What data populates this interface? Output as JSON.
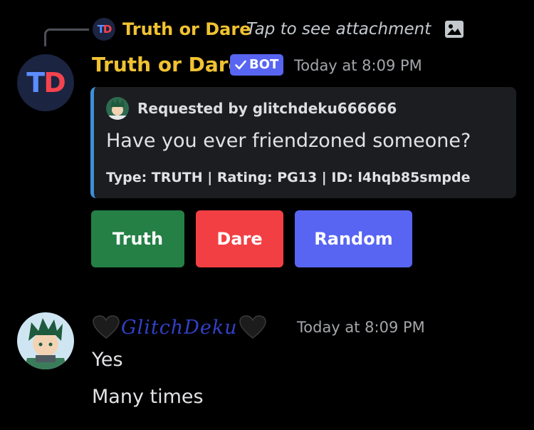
{
  "reply": {
    "author": "Truth or Dare",
    "preview": "Tap to see attachment",
    "avatar_initials": [
      "T",
      "D"
    ],
    "attachment_icon": "image-icon"
  },
  "bot_message": {
    "author": "Truth or Dare",
    "badge": "BOT",
    "badge_icon": "checkmark-icon",
    "timestamp": "Today at 8:09 PM",
    "avatar_initials": [
      "T",
      "D"
    ],
    "embed": {
      "accent_color": "#3c8fd6",
      "author": "Requested by glitchdeku666666",
      "description": "Have you ever friendzoned someone?",
      "footer": "Type: TRUTH | Rating: PG13 | ID: l4hqb85smpde"
    },
    "buttons": [
      {
        "label": "Truth",
        "color": "#248045"
      },
      {
        "label": "Dare",
        "color": "#f23f43"
      },
      {
        "label": "Random",
        "color": "#5865f2"
      }
    ]
  },
  "user_message": {
    "author": "GlitchDeku",
    "author_decoration": "black-heart-icon",
    "timestamp": "Today at 8:09 PM",
    "lines": [
      "Yes",
      "Many times"
    ]
  },
  "colors": {
    "background": "#000000",
    "author_gold": "#f0c232",
    "blurple": "#5865f2"
  }
}
